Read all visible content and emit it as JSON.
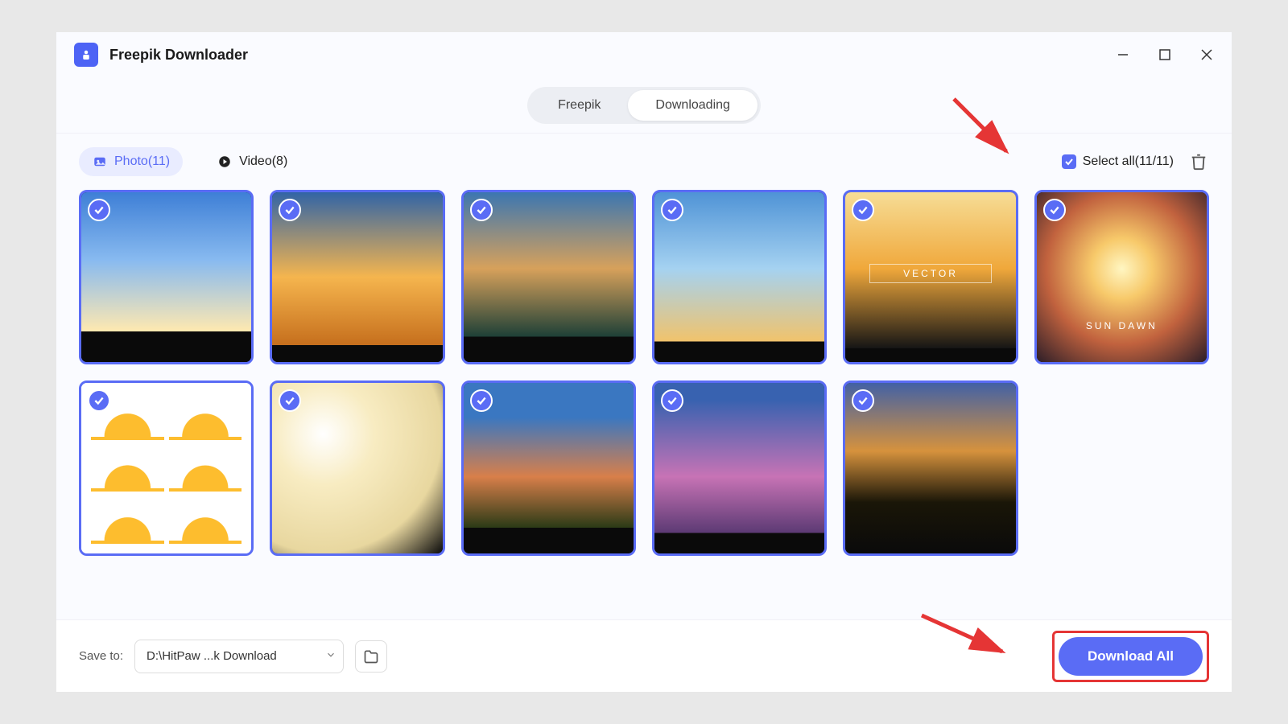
{
  "titlebar": {
    "title": "Freepik Downloader"
  },
  "topnav": {
    "tab_freepik": "Freepik",
    "tab_downloading": "Downloading"
  },
  "filterbar": {
    "photo_label": "Photo(11)",
    "video_label": "Video(8)",
    "select_all_label": "Select all(11/11)"
  },
  "thumbnails": {
    "count": 11,
    "selected": 11
  },
  "footer": {
    "save_to_label": "Save to:",
    "path_value": "D:\\HitPaw ...k Download",
    "download_button": "Download All"
  },
  "colors": {
    "accent": "#5a6cf5",
    "highlight": "#e53535"
  }
}
